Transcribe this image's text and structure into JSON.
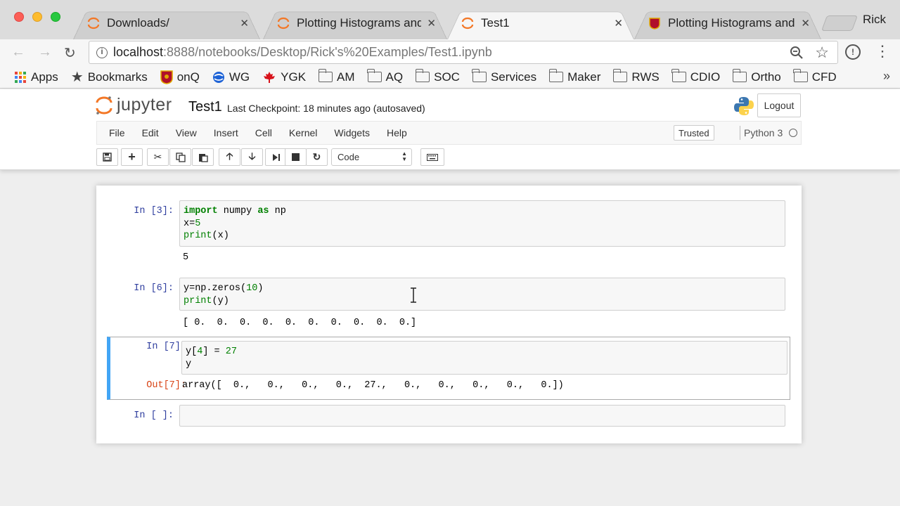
{
  "browser": {
    "tabs": [
      {
        "title": "Downloads/",
        "active": false
      },
      {
        "title": "Plotting Histograms and D",
        "active": false
      },
      {
        "title": "Test1",
        "active": true
      },
      {
        "title": "Plotting Histograms and D",
        "active": false
      }
    ],
    "close_glyph": "✕",
    "profile_name": "Rick",
    "url_host": "localhost",
    "url_path": ":8888/notebooks/Desktop/Rick's%20Examples/Test1.ipynb",
    "bookmarks": [
      {
        "label": "Apps",
        "icon": "apps-grid-icon"
      },
      {
        "label": "Bookmarks",
        "icon": "star-icon"
      },
      {
        "label": "onQ",
        "icon": "crest-icon"
      },
      {
        "label": "WG",
        "icon": "globe-icon"
      },
      {
        "label": "YGK",
        "icon": "maple-leaf-icon"
      },
      {
        "label": "AM",
        "icon": "folder-icon"
      },
      {
        "label": "AQ",
        "icon": "folder-icon"
      },
      {
        "label": "SOC",
        "icon": "folder-icon"
      },
      {
        "label": "Services",
        "icon": "folder-icon"
      },
      {
        "label": "Maker",
        "icon": "folder-icon"
      },
      {
        "label": "RWS",
        "icon": "folder-icon"
      },
      {
        "label": "CDIO",
        "icon": "folder-icon"
      },
      {
        "label": "Ortho",
        "icon": "folder-icon"
      },
      {
        "label": "CFD",
        "icon": "folder-icon"
      }
    ],
    "bookmarks_more": "»"
  },
  "jupyter": {
    "logo_text": "jupyter",
    "notebook_name": "Test1",
    "checkpoint": "Last Checkpoint: 18 minutes ago (autosaved)",
    "logout_label": "Logout",
    "menu": [
      "File",
      "Edit",
      "View",
      "Insert",
      "Cell",
      "Kernel",
      "Widgets",
      "Help"
    ],
    "trusted_label": "Trusted",
    "kernel_name": "Python 3",
    "cell_type": "Code",
    "toolbar_icons": [
      "save-icon",
      "add-cell-icon",
      "cut-icon",
      "copy-icon",
      "paste-icon",
      "move-up-icon",
      "move-down-icon",
      "run-icon",
      "stop-icon",
      "restart-icon",
      "keyboard-icon"
    ]
  },
  "cells": [
    {
      "prompt": "In [3]:",
      "lines": [
        [
          {
            "t": "import",
            "c": "kw"
          },
          {
            "t": " numpy "
          },
          {
            "t": "as",
            "c": "kw"
          },
          {
            "t": " np"
          }
        ],
        [
          {
            "t": "x="
          },
          {
            "t": "5",
            "c": "num"
          }
        ],
        [
          {
            "t": "print",
            "c": "bi"
          },
          {
            "t": "(x)"
          }
        ]
      ],
      "output": "5"
    },
    {
      "prompt": "In [6]:",
      "lines": [
        [
          {
            "t": "y=np.zeros("
          },
          {
            "t": "10",
            "c": "num"
          },
          {
            "t": ")"
          }
        ],
        [
          {
            "t": "print",
            "c": "bi"
          },
          {
            "t": "(y)"
          }
        ]
      ],
      "output": "[ 0.  0.  0.  0.  0.  0.  0.  0.  0.  0.]"
    },
    {
      "prompt": "In [7]:",
      "lines": [
        [
          {
            "t": "y["
          },
          {
            "t": "4",
            "c": "num"
          },
          {
            "t": "] = "
          },
          {
            "t": "27",
            "c": "num"
          }
        ],
        [
          {
            "t": "y"
          }
        ]
      ],
      "out_prompt": "Out[7]:",
      "output": "array([  0.,   0.,   0.,   0.,  27.,   0.,   0.,   0.,   0.,   0.])"
    },
    {
      "prompt": "In [ ]:",
      "lines": [],
      "output": ""
    }
  ]
}
